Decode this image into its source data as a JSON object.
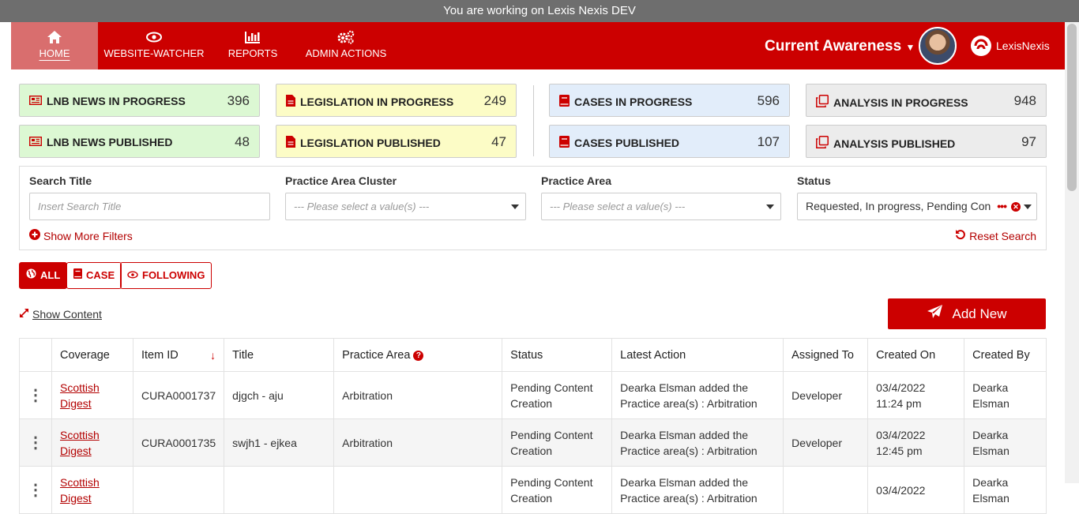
{
  "env_banner": "You are working on Lexis Nexis DEV",
  "nav": {
    "items": [
      {
        "label": "HOME",
        "icon": "home-icon"
      },
      {
        "label": "WEBSITE-WATCHER",
        "icon": "eye-icon"
      },
      {
        "label": "REPORTS",
        "icon": "bar-chart-icon"
      },
      {
        "label": "ADMIN ACTIONS",
        "icon": "gears-icon"
      }
    ],
    "module": "Current Awareness",
    "brand": "LexisNexis"
  },
  "counters": {
    "lnb_news_in_progress": {
      "label": "LNB NEWS IN PROGRESS",
      "value": "396"
    },
    "lnb_news_published": {
      "label": "LNB NEWS PUBLISHED",
      "value": "48"
    },
    "legislation_in_progress": {
      "label": "LEGISLATION IN PROGRESS",
      "value": "249"
    },
    "legislation_published": {
      "label": "LEGISLATION PUBLISHED",
      "value": "47"
    },
    "cases_in_progress": {
      "label": "CASES IN PROGRESS",
      "value": "596"
    },
    "cases_published": {
      "label": "CASES PUBLISHED",
      "value": "107"
    },
    "analysis_in_progress": {
      "label": "ANALYSIS IN PROGRESS",
      "value": "948"
    },
    "analysis_published": {
      "label": "ANALYSIS PUBLISHED",
      "value": "97"
    }
  },
  "filters": {
    "search_title_label": "Search Title",
    "search_title_placeholder": "Insert Search Title",
    "cluster_label": "Practice Area Cluster",
    "cluster_placeholder": "--- Please select a value(s) ---",
    "area_label": "Practice Area",
    "area_placeholder": "--- Please select a value(s) ---",
    "status_label": "Status",
    "status_value": "Requested, In progress, Pending Con",
    "show_more": "Show More Filters",
    "reset": "Reset Search"
  },
  "tabs": {
    "all": "ALL",
    "case": "CASE",
    "following": "FOLLOWING"
  },
  "show_content": "Show Content",
  "add_new": "Add New",
  "table": {
    "headers": {
      "coverage": "Coverage",
      "item_id": "Item ID",
      "title": "Title",
      "practice_area": "Practice Area",
      "status": "Status",
      "latest_action": "Latest Action",
      "assigned_to": "Assigned To",
      "created_on": "Created On",
      "created_by": "Created By"
    },
    "rows": [
      {
        "coverage": "Scottish Digest",
        "item_id": "CURA0001737",
        "title": "djgch - aju",
        "practice_area": "Arbitration",
        "status": "Pending Content Creation",
        "latest_action": "Dearka  Elsman added the Practice area(s) : Arbitration",
        "assigned_to": "Developer",
        "created_on_date": "03/4/2022",
        "created_on_time": "11:24 pm",
        "created_by": "Dearka Elsman"
      },
      {
        "coverage": "Scottish Digest",
        "item_id": "CURA0001735",
        "title": "swjh1 - ejkea",
        "practice_area": "Arbitration",
        "status": "Pending Content Creation",
        "latest_action": "Dearka  Elsman added the Practice area(s) : Arbitration",
        "assigned_to": "Developer",
        "created_on_date": "03/4/2022",
        "created_on_time": "12:45 pm",
        "created_by": "Dearka Elsman"
      },
      {
        "coverage": "Scottish Digest",
        "item_id": "",
        "title": "",
        "practice_area": "",
        "status": "Pending Content Creation",
        "latest_action": "Dearka  Elsman added the Practice area(s) : Arbitration",
        "assigned_to": "",
        "created_on_date": "03/4/2022",
        "created_on_time": "",
        "created_by": "Dearka Elsman"
      }
    ]
  }
}
